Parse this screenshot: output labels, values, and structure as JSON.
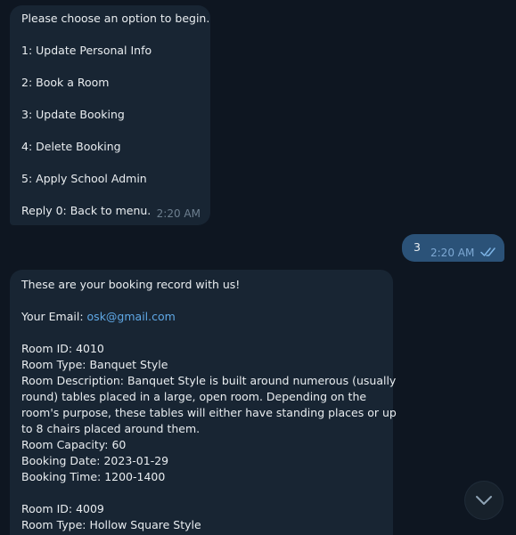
{
  "menu_message": {
    "lines": [
      "Please choose an option to begin.",
      "",
      "1: Update Personal Info",
      "",
      "2: Book a Room",
      "",
      "3: Update Booking",
      "",
      "4: Delete Booking",
      "",
      "5: Apply School Admin",
      ""
    ],
    "last_line": "Reply 0: Back to menu.",
    "time": "2:20 AM"
  },
  "user_message": {
    "text": "3",
    "time": "2:20 AM",
    "status_icon": "double-check-icon"
  },
  "booking_message": {
    "intro": "These are your booking record with us!",
    "email_label": "Your Email: ",
    "email": "osk@gmail.com",
    "record1": {
      "room_id": "Room ID: 4010",
      "room_type": "Room Type: Banquet Style",
      "desc_lines": [
        "Room Description: Banquet Style is built around numerous (usually",
        "round) tables placed in a large, open room. Depending on the",
        "room's purpose, these tables will either have standing places or up",
        "to 8 chairs placed around them."
      ],
      "capacity": "Room Capacity: 60",
      "date": "Booking Date: 2023-01-29",
      "time": "Booking Time: 1200-1400"
    },
    "record2": {
      "room_id": "Room ID: 4009",
      "room_type": "Room Type: Hollow Square Style"
    }
  },
  "scroll_button": {
    "icon": "chevron-down-icon"
  },
  "colors": {
    "background": "#0e1621",
    "incoming_bubble": "#182533",
    "outgoing_bubble": "#2b5278",
    "link": "#5fa8e6"
  }
}
